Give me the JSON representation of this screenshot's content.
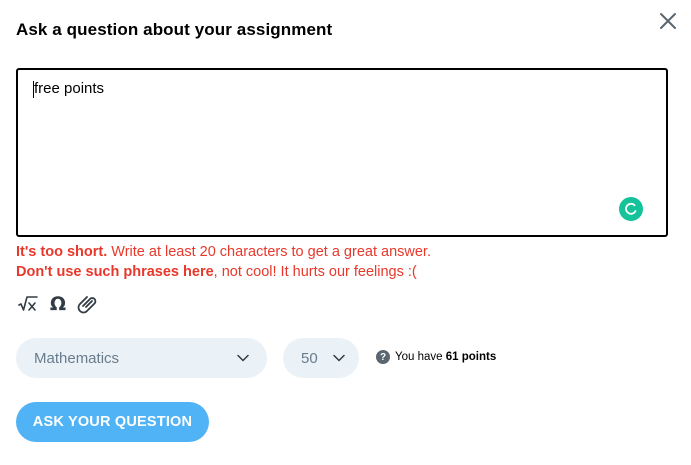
{
  "dialog": {
    "title": "Ask a question about your assignment"
  },
  "question": {
    "value": "free points"
  },
  "errors": {
    "line1_bold": "It's too short.",
    "line1_rest": " Write at least 20 characters to get a great answer.",
    "line2_bold": "Don't use such phrases here",
    "line2_rest": ", not cool! It hurts our feelings :("
  },
  "toolbar": {
    "icons": [
      "equation-icon",
      "symbol-icon",
      "attachment-icon"
    ],
    "symbol_glyph": "Ω"
  },
  "subject": {
    "selected": "Mathematics"
  },
  "points": {
    "selected": "50",
    "info_prefix": "You have ",
    "info_points": "61 points"
  },
  "actions": {
    "ask_label": "ASK YOUR QUESTION"
  },
  "colors": {
    "error": "#e8382b",
    "primary_button": "#4fb3f6",
    "select_bg": "#ebf2f7",
    "grammarly": "#15c39a"
  }
}
